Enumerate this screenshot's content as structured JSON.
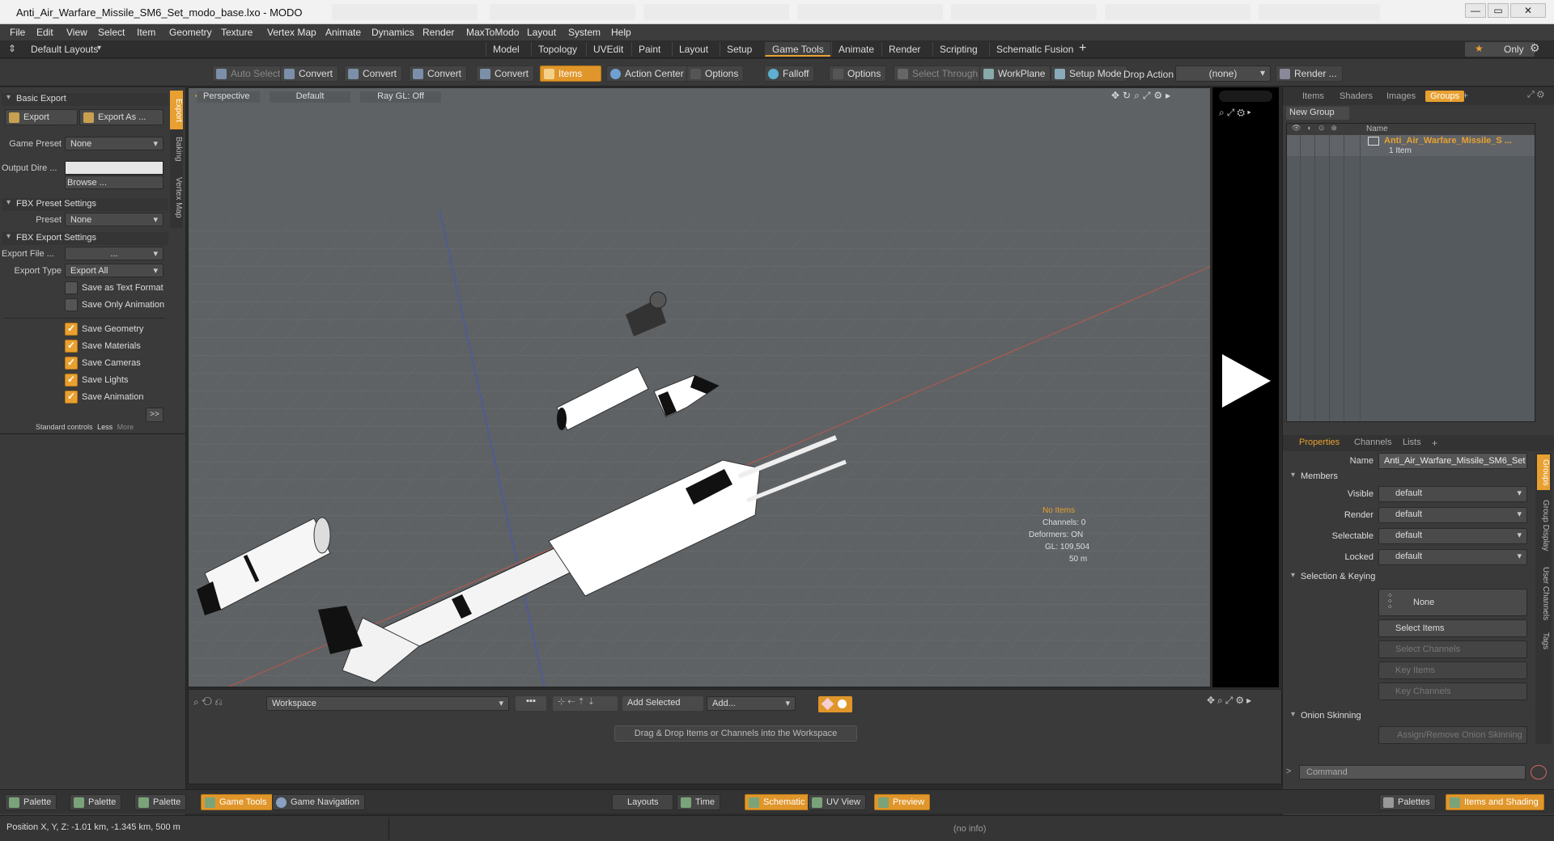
{
  "window": {
    "title": "Anti_Air_Warfare_Missile_SM6_Set_modo_base.lxo - MODO",
    "minimize": "—",
    "maximize": "▭",
    "close": "✕"
  },
  "menu": [
    "File",
    "Edit",
    "View",
    "Select",
    "Item",
    "Geometry",
    "Texture",
    "Vertex Map",
    "Animate",
    "Dynamics",
    "Render",
    "MaxToModo",
    "Layout",
    "System",
    "Help"
  ],
  "layouts_label": "Default Layouts",
  "tabs": [
    "Model",
    "Topology",
    "UVEdit",
    "Paint",
    "Layout",
    "Setup",
    "Game Tools",
    "Animate",
    "Render",
    "Scripting",
    "Schematic Fusion"
  ],
  "active_tab": "Game Tools",
  "only_label": "Only",
  "toolbar": {
    "auto_select": "Auto Select",
    "convert": "Convert",
    "items": "Items",
    "action_center": "Action Center",
    "options": "Options",
    "falloff": "Falloff",
    "select_through": "Select Through",
    "workplane": "WorkPlane",
    "setup_mode": "Setup Mode",
    "drop_action": "Drop Action",
    "drop_value": "(none)",
    "render": "Render ..."
  },
  "left": {
    "basic_export": "Basic Export",
    "export_btn": "Export",
    "export_as_btn": "Export As ...",
    "game_preset_label": "Game Preset",
    "game_preset_value": "None",
    "output_dir_label": "Output Dire ...",
    "browse": "Browse ...",
    "fbx_preset_settings": "FBX Preset Settings",
    "preset_label": "Preset",
    "preset_value": "None",
    "fbx_export_settings": "FBX Export Settings",
    "export_file_label": "Export File ...",
    "export_file_value": "...",
    "export_type_label": "Export Type",
    "export_type_value": "Export All",
    "checkboxes": [
      {
        "label": "Save as Text Format",
        "checked": false
      },
      {
        "label": "Save Only Animation",
        "checked": false
      },
      {
        "label": "Save Geometry",
        "checked": true
      },
      {
        "label": "Save Materials",
        "checked": true
      },
      {
        "label": "Save Cameras",
        "checked": true
      },
      {
        "label": "Save Lights",
        "checked": true
      },
      {
        "label": "Save Animation",
        "checked": true
      }
    ],
    "more_arrow": ">>",
    "std_controls": "Standard controls",
    "less": "Less",
    "more": "More",
    "vtabs": [
      "Export",
      "Baking",
      "Vertex Map"
    ]
  },
  "viewport": {
    "view": "Perspective",
    "shading": "Default",
    "raygl": "Ray GL: Off",
    "info_no_items": "No Items",
    "info_channels": "Channels: 0",
    "info_deformers": "Deformers: ON",
    "info_gl": "GL: 109,504",
    "info_scale": "50 m"
  },
  "right": {
    "tabs": [
      "Items",
      "Shaders",
      "Images",
      "Groups"
    ],
    "active_tab": "Groups",
    "new_group": "New Group",
    "col_name": "Name",
    "group_name": "Anti_Air_Warfare_Missile_S ...",
    "group_count": "1 Item",
    "prop_tabs": [
      "Properties",
      "Channels",
      "Lists"
    ],
    "name_label": "Name",
    "name_value": "Anti_Air_Warfare_Missile_SM6_Set",
    "members": "Members",
    "visible_label": "Visible",
    "render_label": "Render",
    "selectable_label": "Selectable",
    "locked_label": "Locked",
    "default_value": "default",
    "selection_keying": "Selection & Keying",
    "none": "None",
    "select_items": "Select Items",
    "select_channels": "Select Channels",
    "key_items": "Key Items",
    "key_channels": "Key Channels",
    "onion_skinning": "Onion Skinning",
    "assign_onion": "Assign/Remove Onion Skinning",
    "command_placeholder": "Command",
    "side_tabs": [
      "Groups",
      "Group Display",
      "User Channels",
      "Tags"
    ]
  },
  "schematic": {
    "workspace": "Workspace",
    "add_selected": "Add Selected",
    "add": "Add...",
    "hint": "Drag & Drop Items or Channels into the Workspace"
  },
  "bottom": {
    "palette": "Palette",
    "game_tools": "Game Tools",
    "game_navigation": "Game Navigation",
    "layouts": "Layouts",
    "time": "Time",
    "schematic": "Schematic",
    "uv_view": "UV View",
    "preview": "Preview",
    "palettes": "Palettes",
    "items_shading": "Items and Shading"
  },
  "status": {
    "position": "Position X, Y, Z:  -1.01 km, -1.345 km, 500 m",
    "info": "(no info)"
  },
  "colors": {
    "accent": "#e8a030",
    "panel": "#3a3a3a",
    "viewport": "#5e6265"
  }
}
